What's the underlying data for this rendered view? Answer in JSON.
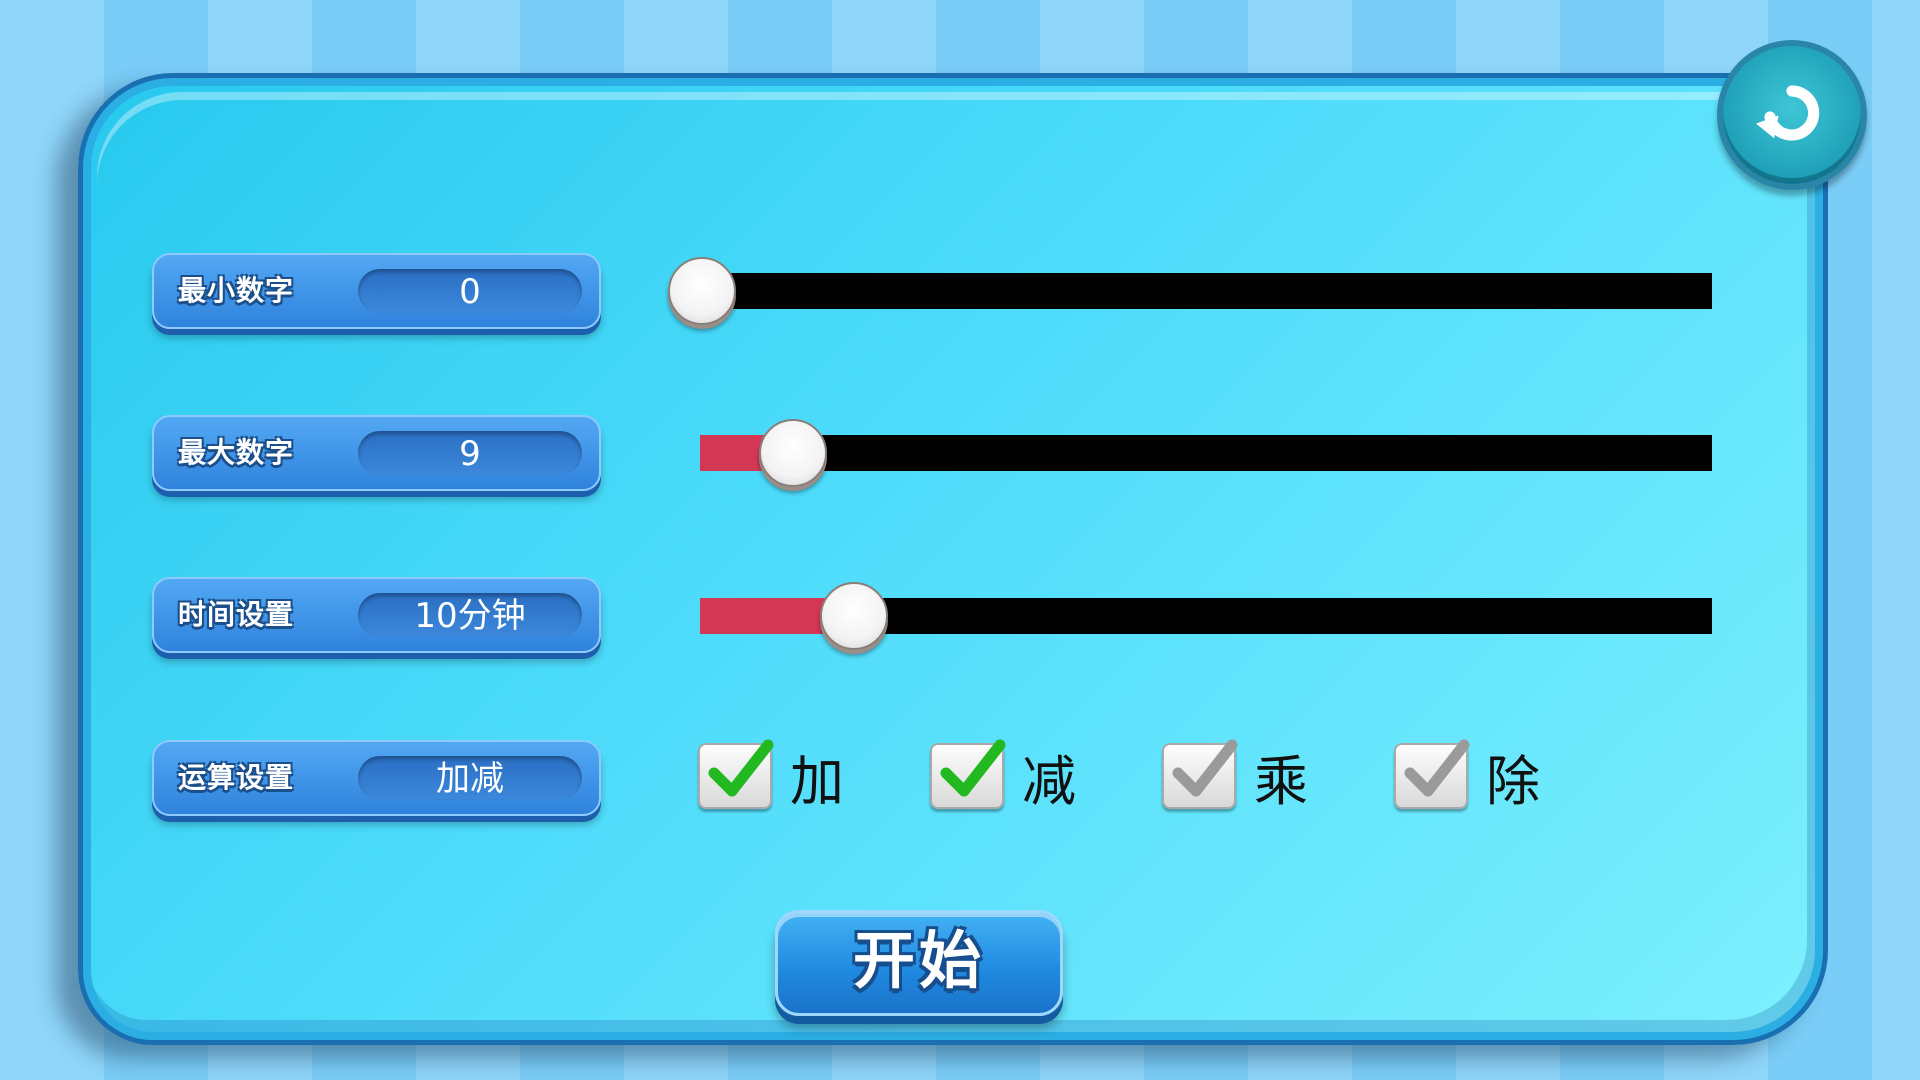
{
  "settings": {
    "min_number": {
      "label": "最小数字",
      "value": "0",
      "slider_fraction": 0.0
    },
    "max_number": {
      "label": "最大数字",
      "value": "9",
      "slider_fraction": 0.09
    },
    "time": {
      "label": "时间设置",
      "value": "10分钟",
      "slider_fraction": 0.15
    },
    "operations": {
      "label": "运算设置",
      "value": "加减"
    }
  },
  "operations": [
    {
      "label": "加",
      "checked": true
    },
    {
      "label": "减",
      "checked": true
    },
    {
      "label": "乘",
      "checked": false
    },
    {
      "label": "除",
      "checked": false
    }
  ],
  "start_label": "开始",
  "icons": {
    "back": "back-arrow-icon",
    "check": "checkmark-icon"
  },
  "colors": {
    "fill": "#d23853",
    "track": "#000000",
    "check_on": "#22b820",
    "check_off": "#9a9a9a"
  }
}
